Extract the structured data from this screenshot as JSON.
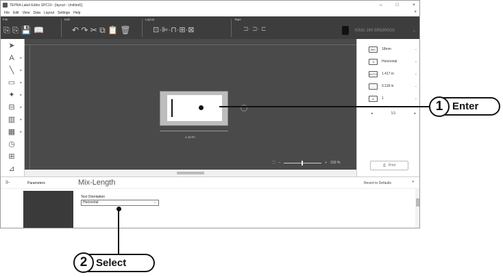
{
  "window": {
    "title": "TEPRA Label Editor SPC10 - [layout - Untitled1]",
    "min_icon": "–",
    "max_icon": "□",
    "close_icon": "×"
  },
  "menu": {
    "items": [
      "File",
      "Edit",
      "View",
      "Data",
      "Layout",
      "Settings",
      "Help"
    ],
    "close_glyph": "×"
  },
  "ribbon": {
    "file_label": "File",
    "edit_label": "Edit",
    "layout_label": "Layout",
    "tape_label": "Tape",
    "file_icons": "⎘ ⎘ 💾 📖",
    "edit_icons": "↶ ↷ ✂ ⧉ 📋 🗑",
    "layout_icons": "⊡·⊫·⊓·⊞·⊠",
    "tape_icons": "⊐· ⊐· ⊏",
    "printer_name": "KING JIM SR5900GS"
  },
  "canvas": {
    "label_length": "1.417in",
    "zoom_level": "150 %",
    "zoom_minus": "–",
    "zoom_plus": "+"
  },
  "properties": {
    "rows": [
      {
        "icon": "ABC",
        "value": "18mm"
      },
      {
        "icon": "⇥",
        "value": "Horizontal"
      },
      {
        "icon": "AUTO",
        "value": "1.417 in"
      },
      {
        "icon": "↔",
        "value": "0.118 in"
      },
      {
        "icon": "A",
        "value": "1"
      }
    ],
    "page_prev": "◂",
    "page_indicator": "1/1",
    "page_next": "▸",
    "print_label": "Print"
  },
  "parameters": {
    "label": "Parameters",
    "title": "Mix-Length",
    "revert_label": "Revert to Defaults",
    "collapse_glyph": "»",
    "text_orientation_label": "Text Orientation",
    "text_orientation_value": "Horizontal"
  },
  "callouts": {
    "step1_number": "1",
    "step1_label": "Enter",
    "step2_number": "2",
    "step2_label": "Select"
  }
}
